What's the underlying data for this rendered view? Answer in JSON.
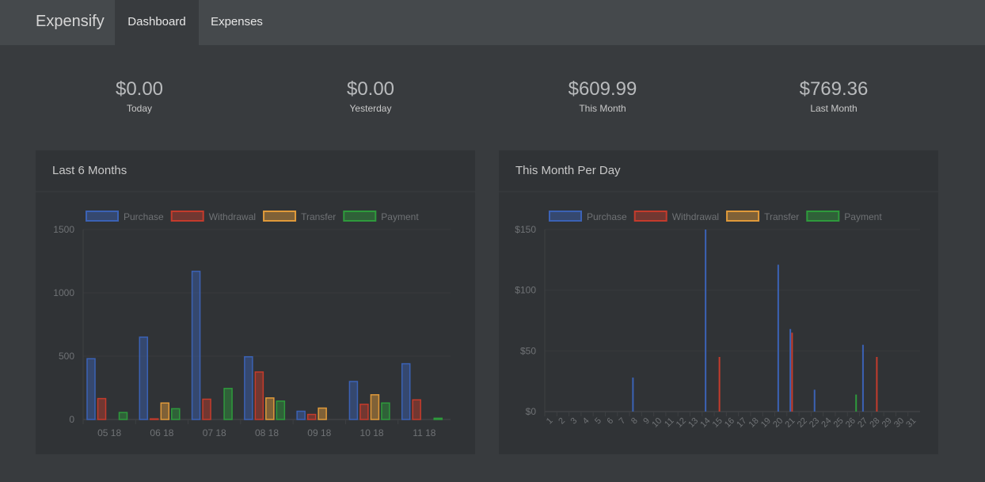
{
  "navbar": {
    "brand": "Expensify",
    "tabs": [
      {
        "label": "Dashboard",
        "active": true
      },
      {
        "label": "Expenses",
        "active": false
      }
    ]
  },
  "stats": [
    {
      "value": "$0.00",
      "label": "Today"
    },
    {
      "value": "$0.00",
      "label": "Yesterday"
    },
    {
      "value": "$609.99",
      "label": "This Month"
    },
    {
      "value": "$769.36",
      "label": "Last Month"
    }
  ],
  "colors": {
    "purchase": "#3b62b5",
    "withdrawal": "#c43b2c",
    "transfer": "#e09a3a",
    "payment": "#2e9a3c"
  },
  "chart_data": [
    {
      "type": "bar",
      "title": "Last 6 Months",
      "categories": [
        "05 18",
        "06 18",
        "07 18",
        "08 18",
        "09 18",
        "10 18",
        "11 18"
      ],
      "ylim": [
        0,
        1500
      ],
      "yticks": [
        "0",
        "500",
        "1000",
        "1500"
      ],
      "legend": "top",
      "grid": true,
      "series": [
        {
          "name": "Purchase",
          "values": [
            480,
            650,
            1170,
            495,
            65,
            300,
            440
          ]
        },
        {
          "name": "Withdrawal",
          "values": [
            165,
            5,
            160,
            375,
            40,
            120,
            155
          ]
        },
        {
          "name": "Transfer",
          "values": [
            0,
            130,
            0,
            170,
            90,
            195,
            0
          ]
        },
        {
          "name": "Payment",
          "values": [
            55,
            85,
            245,
            145,
            0,
            130,
            10
          ]
        }
      ]
    },
    {
      "type": "bar",
      "title": "This Month Per Day",
      "categories": [
        "1",
        "2",
        "3",
        "4",
        "5",
        "6",
        "7",
        "8",
        "9",
        "10",
        "11",
        "12",
        "13",
        "14",
        "15",
        "16",
        "17",
        "18",
        "19",
        "20",
        "21",
        "22",
        "23",
        "24",
        "25",
        "26",
        "27",
        "28",
        "29",
        "30",
        "31"
      ],
      "ylim": [
        0,
        150
      ],
      "yticks": [
        "$0",
        "$50",
        "$100",
        "$150"
      ],
      "legend": "top",
      "grid": true,
      "series": [
        {
          "name": "Purchase",
          "values": [
            0,
            0,
            0,
            0,
            0,
            0,
            0,
            28,
            0,
            0,
            0,
            0,
            0,
            150,
            0,
            0,
            0,
            0,
            0,
            121,
            68,
            0,
            18,
            0,
            0,
            0,
            55,
            0,
            0,
            0,
            0
          ]
        },
        {
          "name": "Withdrawal",
          "values": [
            0,
            0,
            0,
            0,
            0,
            0,
            0,
            0,
            0,
            0,
            0,
            0,
            0,
            0,
            45,
            0,
            0,
            0,
            0,
            0,
            65,
            0,
            0,
            0,
            0,
            0,
            0,
            45,
            0,
            0,
            0
          ]
        },
        {
          "name": "Transfer",
          "values": [
            0,
            0,
            0,
            0,
            0,
            0,
            0,
            0,
            0,
            0,
            0,
            0,
            0,
            0,
            0,
            0,
            0,
            0,
            0,
            0,
            0,
            0,
            0,
            0,
            0,
            0,
            0,
            0,
            0,
            0,
            0
          ]
        },
        {
          "name": "Payment",
          "values": [
            0,
            0,
            0,
            0,
            0,
            0,
            0,
            0,
            0,
            0,
            0,
            0,
            0,
            0,
            0,
            0,
            0,
            0,
            0,
            0,
            0,
            0,
            0,
            0,
            0,
            14,
            0,
            0,
            0,
            0,
            0
          ]
        }
      ]
    }
  ]
}
